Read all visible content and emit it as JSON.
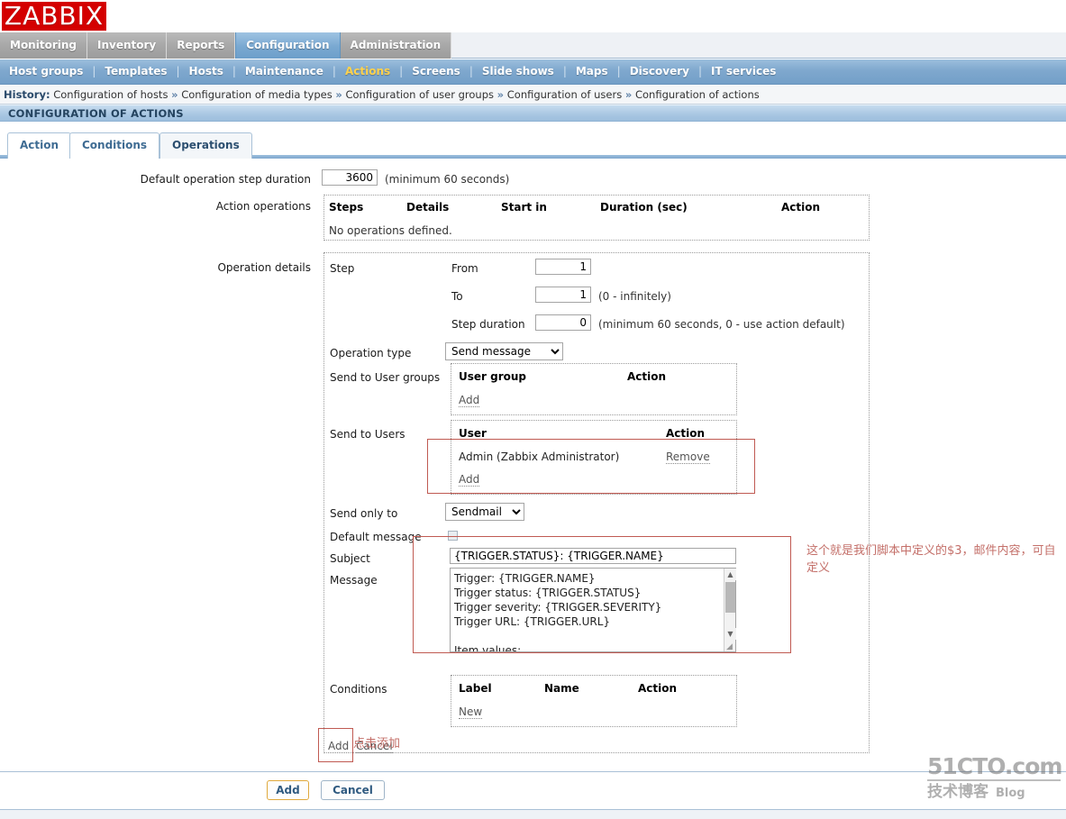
{
  "brand": {
    "logo": "ZABBIX",
    "logo_color": "#d40000"
  },
  "menu1": [
    {
      "label": "Monitoring",
      "selected": false
    },
    {
      "label": "Inventory",
      "selected": false
    },
    {
      "label": "Reports",
      "selected": false
    },
    {
      "label": "Configuration",
      "selected": true
    },
    {
      "label": "Administration",
      "selected": false
    }
  ],
  "menu2": [
    {
      "label": "Host groups",
      "selected": false
    },
    {
      "label": "Templates",
      "selected": false
    },
    {
      "label": "Hosts",
      "selected": false
    },
    {
      "label": "Maintenance",
      "selected": false
    },
    {
      "label": "Actions",
      "selected": true
    },
    {
      "label": "Screens",
      "selected": false
    },
    {
      "label": "Slide shows",
      "selected": false
    },
    {
      "label": "Maps",
      "selected": false
    },
    {
      "label": "Discovery",
      "selected": false
    },
    {
      "label": "IT services",
      "selected": false
    }
  ],
  "history": {
    "label": "History:",
    "items": [
      "Configuration of hosts",
      "Configuration of media types",
      "Configuration of user groups",
      "Configuration of users",
      "Configuration of actions"
    ],
    "separator": "»"
  },
  "page_title": "CONFIGURATION OF ACTIONS",
  "tabs": [
    {
      "label": "Action",
      "selected": false
    },
    {
      "label": "Conditions",
      "selected": false
    },
    {
      "label": "Operations",
      "selected": true
    }
  ],
  "form": {
    "default_step_duration": {
      "label": "Default operation step duration",
      "value": "3600",
      "hint": "(minimum 60 seconds)"
    },
    "action_operations": {
      "label": "Action operations",
      "columns": [
        "Steps",
        "Details",
        "Start in",
        "Duration (sec)",
        "Action"
      ],
      "empty_text": "No operations defined."
    },
    "operation_details": {
      "label": "Operation details",
      "step": {
        "label": "Step",
        "from": {
          "label": "From",
          "value": "1"
        },
        "to": {
          "label": "To",
          "value": "1",
          "hint": "(0 - infinitely)"
        },
        "duration": {
          "label": "Step duration",
          "value": "0",
          "hint": "(minimum 60 seconds, 0 - use action default)"
        }
      },
      "operation_type": {
        "label": "Operation type",
        "value": "Send message"
      },
      "send_to_user_groups": {
        "label": "Send to User groups",
        "columns": [
          "User group",
          "Action"
        ],
        "rows": [],
        "add_link": "Add"
      },
      "send_to_users": {
        "label": "Send to Users",
        "columns": [
          "User",
          "Action"
        ],
        "rows": [
          {
            "user": "Admin (Zabbix Administrator)",
            "action": "Remove"
          }
        ],
        "add_link": "Add"
      },
      "send_only_to": {
        "label": "Send only to",
        "value": "Sendmail"
      },
      "default_message": {
        "label": "Default message",
        "checked": false
      },
      "subject": {
        "label": "Subject",
        "value": "{TRIGGER.STATUS}: {TRIGGER.NAME}"
      },
      "message": {
        "label": "Message",
        "value": "Trigger: {TRIGGER.NAME}\nTrigger status: {TRIGGER.STATUS}\nTrigger severity: {TRIGGER.SEVERITY}\nTrigger URL: {TRIGGER.URL}\n\nItem values:"
      },
      "conditions": {
        "label": "Conditions",
        "columns": [
          "Label",
          "Name",
          "Action"
        ],
        "rows": [],
        "new_link": "New"
      },
      "inline_add": "Add",
      "inline_cancel": "Cancel"
    }
  },
  "footer": {
    "add_label": "Add",
    "cancel_label": "Cancel"
  },
  "annotations": {
    "message_note": "这个就是我们脚本中定义的$3，邮件内容，可自定义",
    "add_note": "点击添加",
    "accent_color": "#c05a52"
  },
  "watermark": {
    "line1": "51CTO.com",
    "line2": "技术博客",
    "line3": "Blog"
  }
}
